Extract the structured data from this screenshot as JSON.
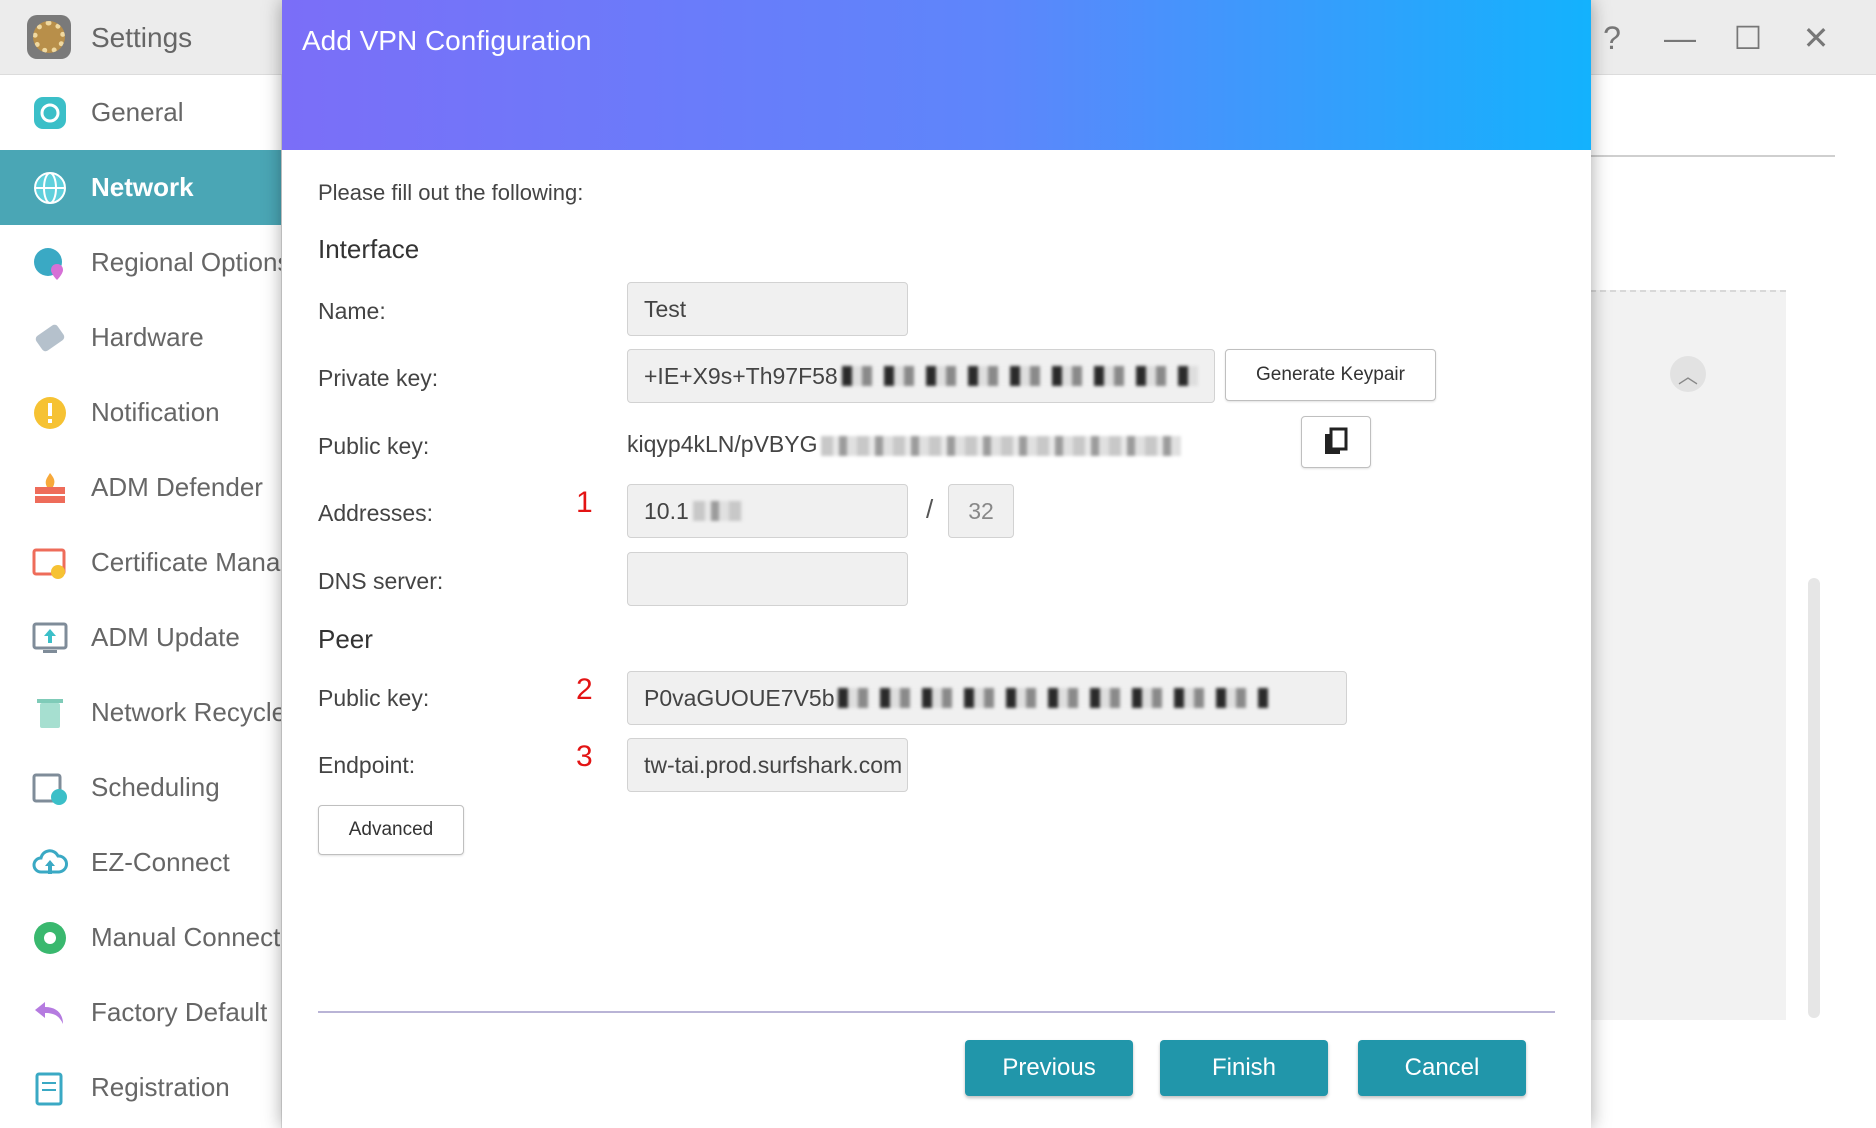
{
  "app": {
    "title": "Settings"
  },
  "window_controls": {
    "help": "?",
    "minimize": "—",
    "maximize": "☐",
    "close": "✕"
  },
  "sidebar": {
    "items": [
      {
        "label": "General",
        "icon": "general-icon",
        "active": false
      },
      {
        "label": "Network",
        "icon": "globe-icon",
        "active": true
      },
      {
        "label": "Regional Options",
        "icon": "regional-icon",
        "active": false
      },
      {
        "label": "Hardware",
        "icon": "hardware-icon",
        "active": false
      },
      {
        "label": "Notification",
        "icon": "notification-icon",
        "active": false
      },
      {
        "label": "ADM Defender",
        "icon": "firewall-icon",
        "active": false
      },
      {
        "label": "Certificate Manager",
        "icon": "certificate-icon",
        "active": false
      },
      {
        "label": "ADM Update",
        "icon": "update-icon",
        "active": false
      },
      {
        "label": "Network Recycle Bin",
        "icon": "recycle-icon",
        "active": false
      },
      {
        "label": "Scheduling",
        "icon": "calendar-icon",
        "active": false
      },
      {
        "label": "EZ-Connect",
        "icon": "cloud-upload-icon",
        "active": false
      },
      {
        "label": "Manual Connect",
        "icon": "connect-icon",
        "active": false
      },
      {
        "label": "Factory Default",
        "icon": "undo-icon",
        "active": false
      },
      {
        "label": "Registration",
        "icon": "registration-icon",
        "active": false
      }
    ]
  },
  "modal": {
    "title": "Add VPN Configuration",
    "intro": "Please fill out the following:",
    "interface": {
      "heading": "Interface",
      "name_label": "Name:",
      "name_value": "Test",
      "private_key_label": "Private key:",
      "private_key_value": "+IE+X9s+Th97F58",
      "generate_keypair_label": "Generate Keypair",
      "public_key_label": "Public key:",
      "public_key_value": "kiqyp4kLN/pVBYG",
      "addresses_label": "Addresses:",
      "addresses_value": "10.1",
      "addresses_prefix": "32",
      "addresses_separator": "/",
      "dns_label": "DNS server:",
      "dns_value": ""
    },
    "peer": {
      "heading": "Peer",
      "public_key_label": "Public key:",
      "public_key_value": "P0vaGUOUE7V5b",
      "endpoint_label": "Endpoint:",
      "endpoint_value": "tw-tai.prod.surfshark.com"
    },
    "advanced_label": "Advanced",
    "annotations": [
      "1",
      "2",
      "3"
    ],
    "buttons": {
      "previous": "Previous",
      "finish": "Finish",
      "cancel": "Cancel"
    },
    "colors": {
      "header_start": "#7b6ef8",
      "header_end": "#13b2fd",
      "primary_button": "#2196aa",
      "annotation": "#e31414"
    }
  }
}
